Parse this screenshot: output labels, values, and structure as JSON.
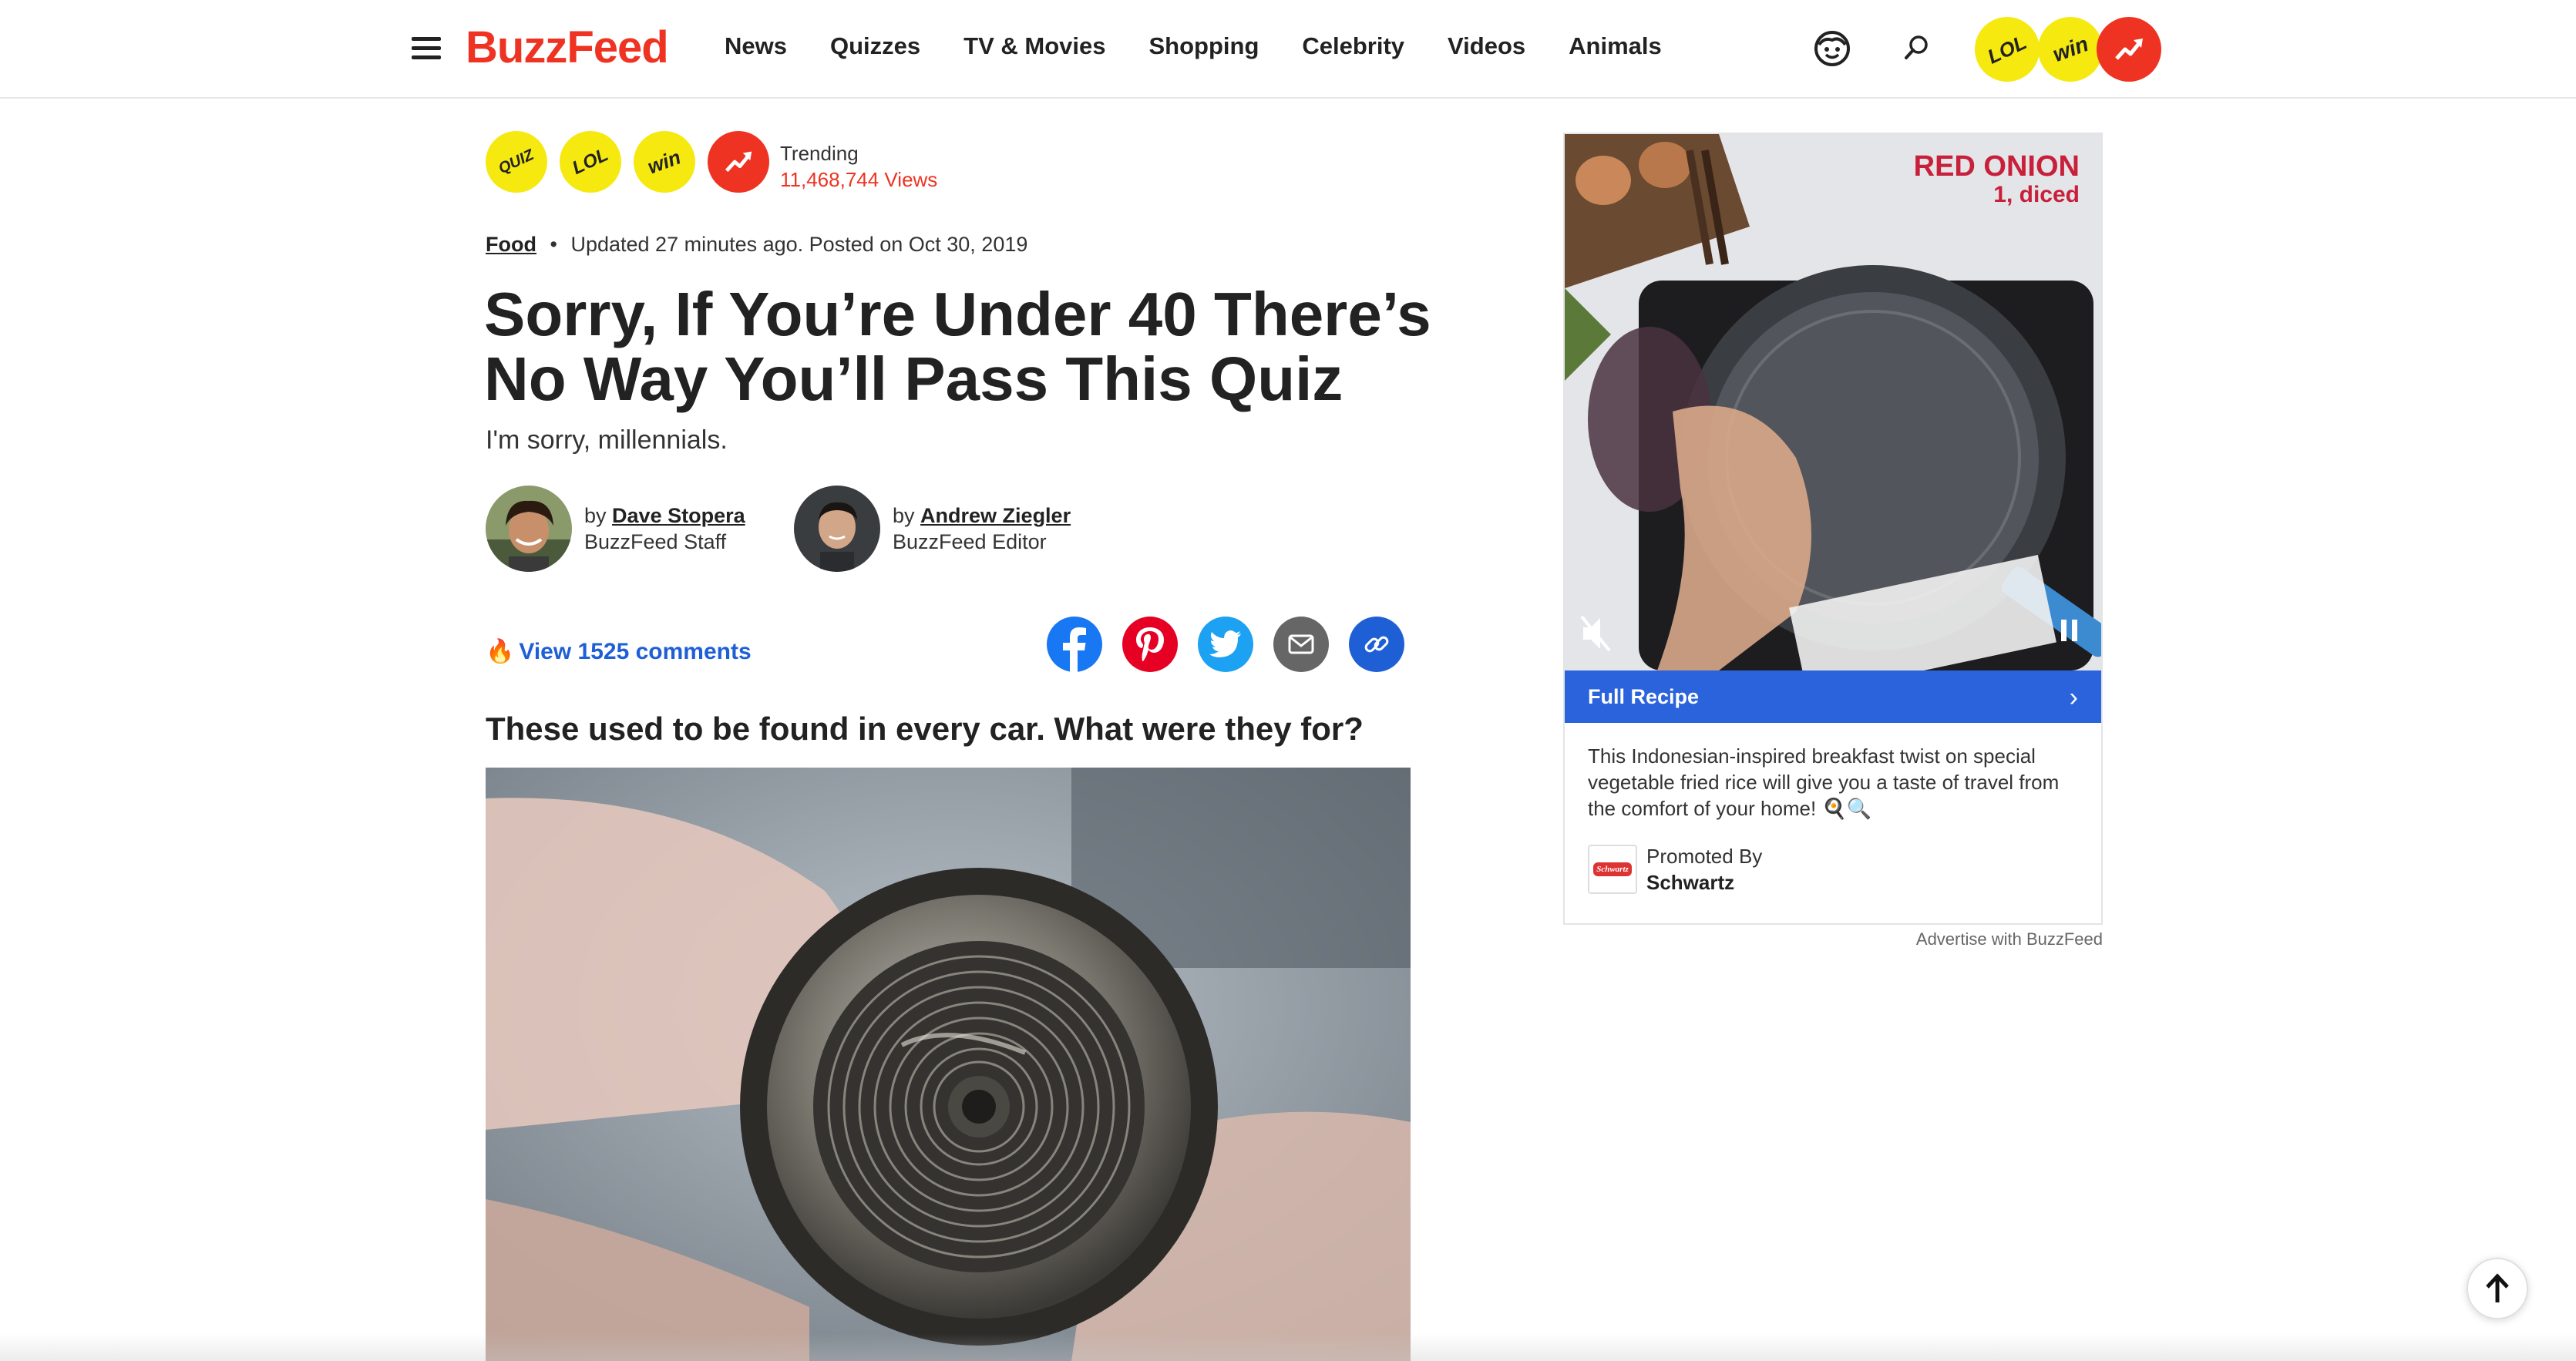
{
  "header": {
    "logo": "BuzzFeed",
    "nav": [
      "News",
      "Quizzes",
      "TV & Movies",
      "Shopping",
      "Celebrity",
      "Videos",
      "Animals"
    ],
    "badges": {
      "lol": "LOL",
      "win": "win"
    }
  },
  "article": {
    "badges": {
      "quiz": "QUIZ",
      "lol": "LOL",
      "win": "win"
    },
    "trending_label": "Trending",
    "trending_views": "11,468,744 Views",
    "category": "Food",
    "meta_separator": "•",
    "updated": "Updated 27 minutes ago. Posted on Oct 30, 2019",
    "title": "Sorry, If You’re Under 40 There’s No Way You’ll Pass This Quiz",
    "dek": "I'm sorry, millennials.",
    "authors": [
      {
        "by": "by",
        "name": "Dave Stopera",
        "role": "BuzzFeed Staff"
      },
      {
        "by": "by",
        "name": "Andrew Ziegler",
        "role": "BuzzFeed Editor"
      }
    ],
    "comments_label": "View 1525 comments",
    "share_icons": [
      "facebook-icon",
      "pinterest-icon",
      "twitter-icon",
      "email-icon",
      "link-icon"
    ],
    "question_title": "These used to be found in every car. What were they for?"
  },
  "ad": {
    "video_text_line1": "RED ONION",
    "video_text_line2": "1, diced",
    "cta_label": "Full Recipe",
    "description": "This Indonesian-inspired breakfast twist on special vegetable fried rice will give you a taste of travel from the comfort of your home! 🍳🔍",
    "promoted_by_label": "Promoted By",
    "sponsor": "Schwartz",
    "sponsor_logo_text": "Schwartz",
    "advertise_label": "Advertise with BuzzFeed"
  },
  "colors": {
    "brand_red": "#ee3322",
    "badge_yellow": "#f5e90f",
    "link_blue": "#1f5fd6",
    "cta_blue": "#2a63dc",
    "facebook": "#1877f2",
    "pinterest": "#e60023",
    "twitter": "#1da1f2",
    "email": "#666666"
  }
}
